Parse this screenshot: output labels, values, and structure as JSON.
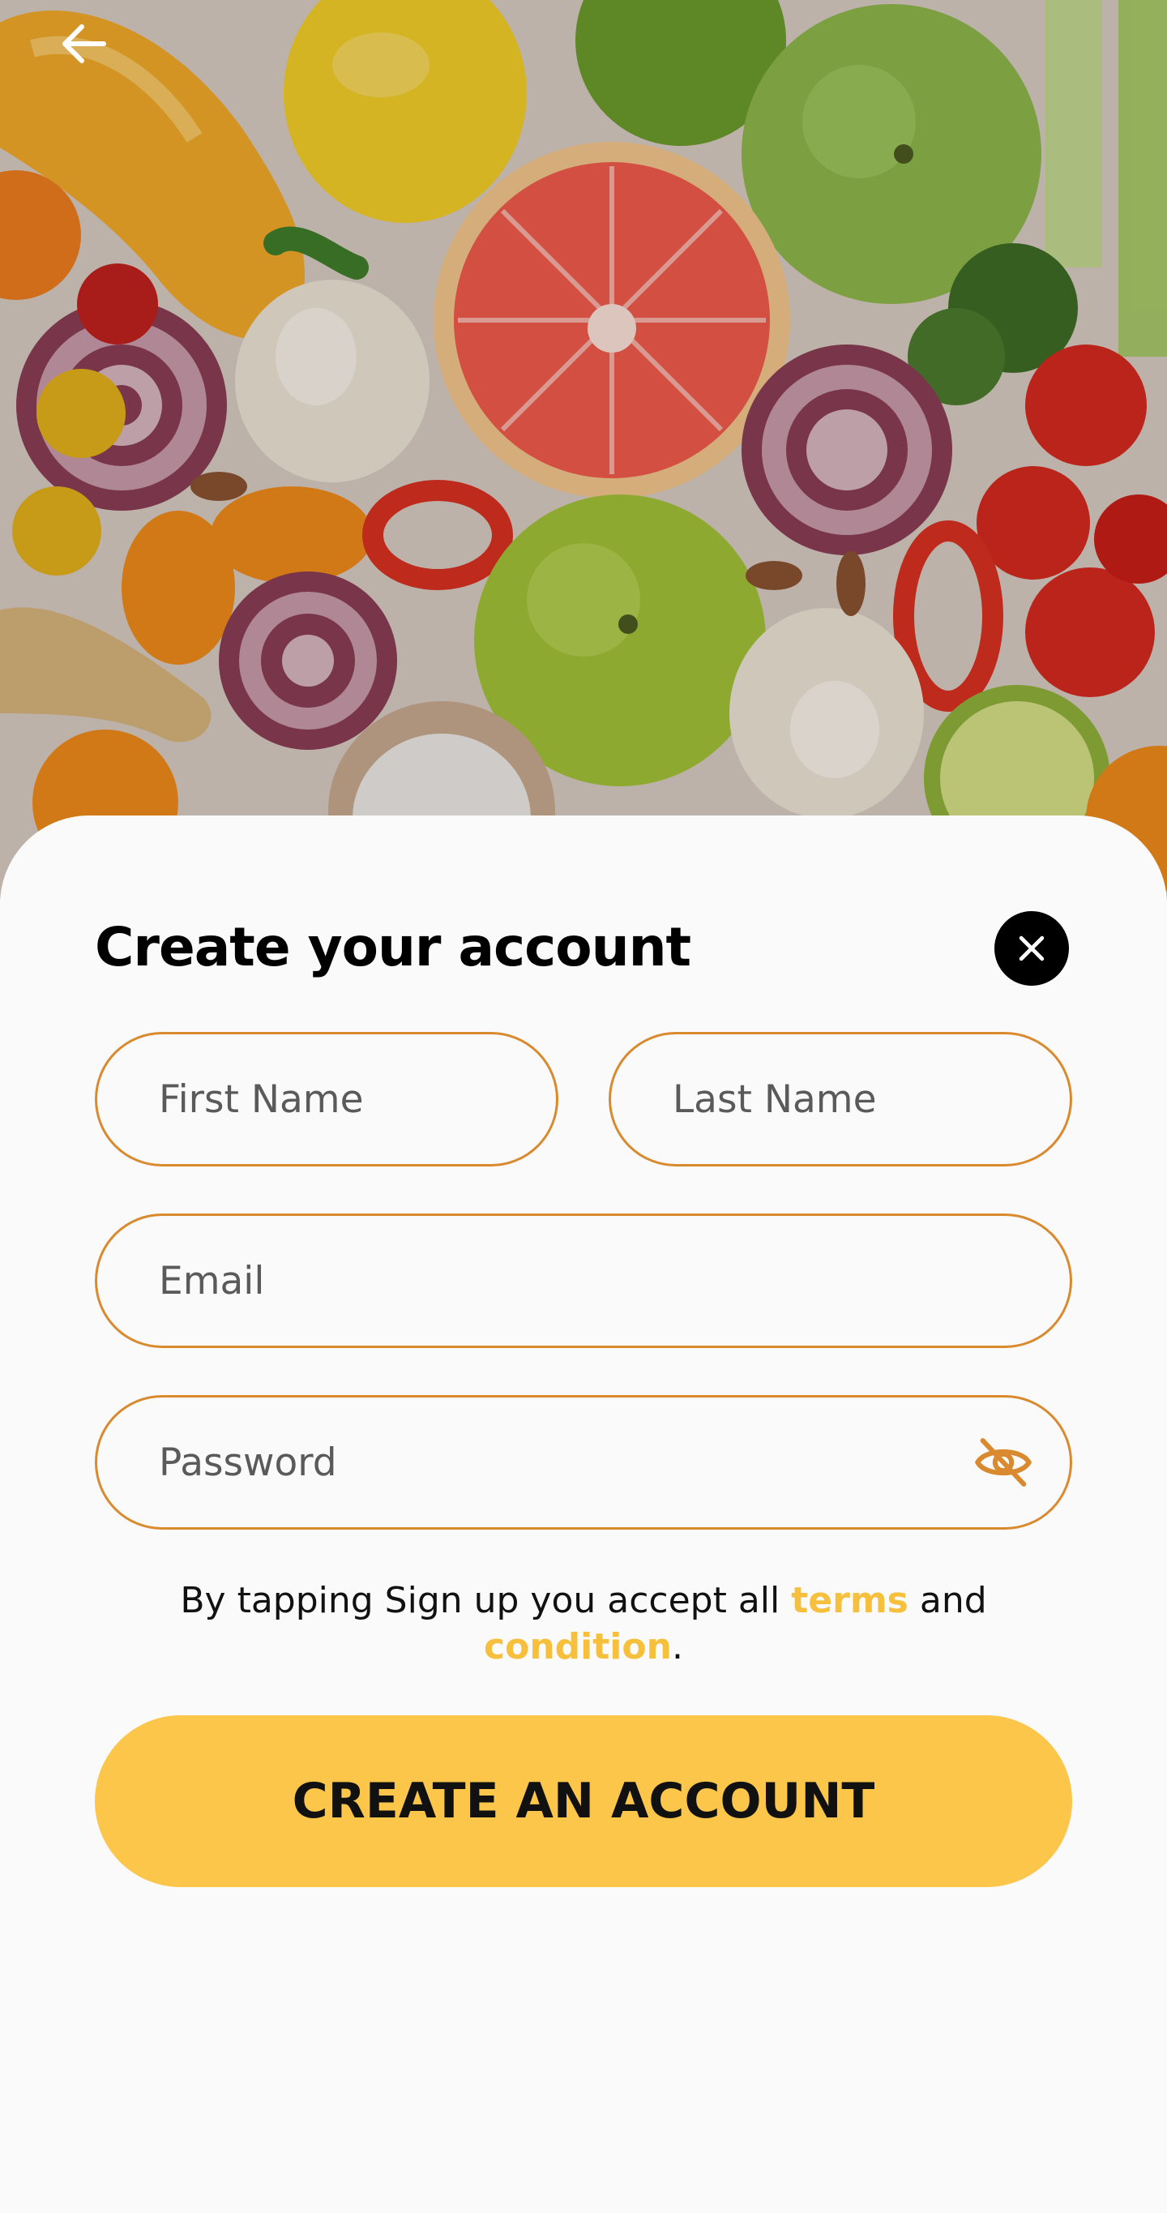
{
  "header": {
    "back_icon": "arrow-left-icon"
  },
  "hero": {
    "image_subject": "assorted fruits and vegetables"
  },
  "form": {
    "title": "Create your account",
    "close_icon": "close-icon",
    "first_name_placeholder": "First Name",
    "last_name_placeholder": "Last Name",
    "email_placeholder": "Email",
    "password_placeholder": "Password",
    "password_toggle_icon": "eye-off-icon"
  },
  "terms": {
    "prefix": "By tapping Sign up you accept all ",
    "terms_link": "terms",
    "middle": " and ",
    "condition_link": "condition",
    "suffix": "."
  },
  "actions": {
    "create_label": "CREATE AN ACCOUNT"
  },
  "colors": {
    "accent": "#fcc64b",
    "field_border": "#d98a2e",
    "link": "#f6bf3c",
    "background": "#fafafa"
  }
}
